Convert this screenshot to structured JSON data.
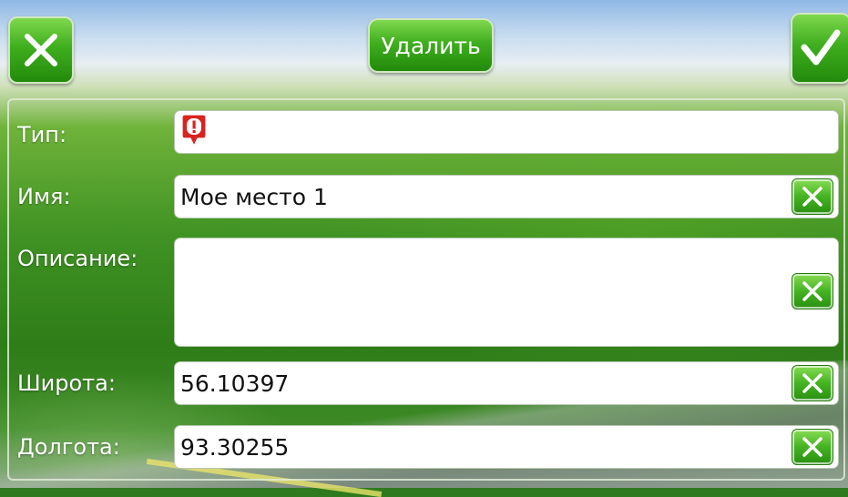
{
  "toolbar": {
    "cancel_icon": "close-x-icon",
    "delete_label": "Удалить",
    "confirm_icon": "checkmark-icon"
  },
  "form": {
    "type": {
      "label": "Тип:",
      "icon": "exclamation-pin-icon",
      "icon_color": "#d8231f"
    },
    "name": {
      "label": "Имя:",
      "value": "Мое место 1",
      "clear_icon": "clear-x-icon"
    },
    "description": {
      "label": "Описание:",
      "value": "",
      "clear_icon": "clear-x-icon"
    },
    "latitude": {
      "label": "Широта:",
      "value": "56.10397",
      "clear_icon": "clear-x-icon"
    },
    "longitude": {
      "label": "Долгота:",
      "value": "93.30255",
      "clear_icon": "clear-x-icon"
    }
  },
  "colors": {
    "button_green": "#3fae1e",
    "field_bg": "#ffffff",
    "label_text": "#ffffff"
  }
}
